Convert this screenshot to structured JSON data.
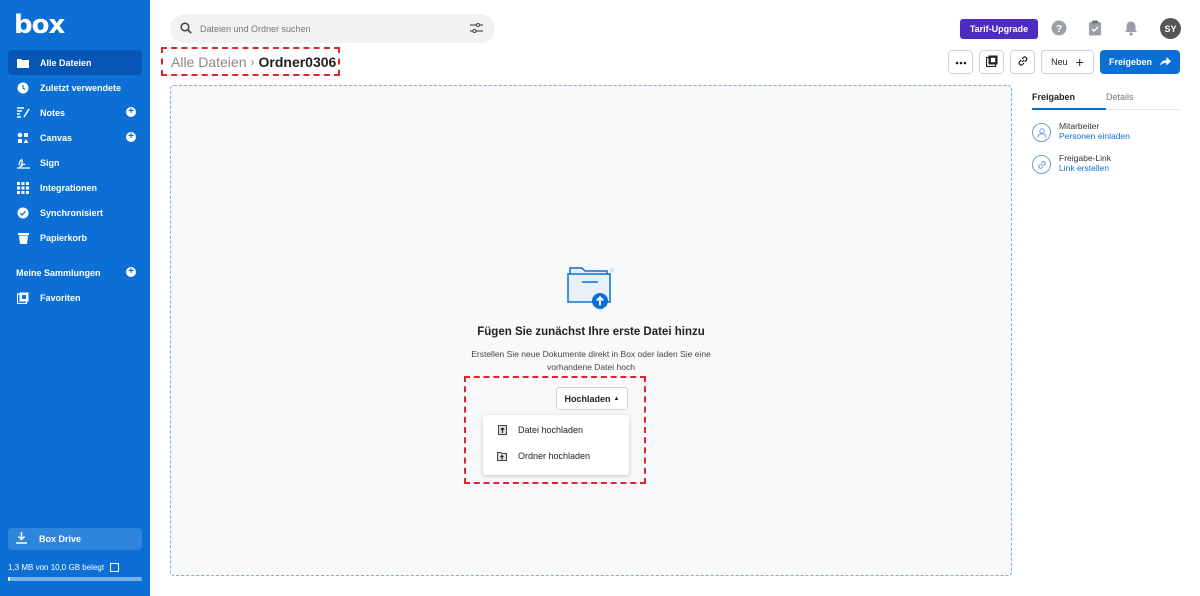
{
  "app": {
    "logo": "box"
  },
  "sidebar": {
    "items": [
      {
        "label": "Alle Dateien",
        "icon": "folder-icon",
        "active": true
      },
      {
        "label": "Zuletzt verwendete",
        "icon": "clock-icon"
      },
      {
        "label": "Notes",
        "icon": "notes-icon",
        "has_add": true
      },
      {
        "label": "Canvas",
        "icon": "canvas-icon",
        "has_add": true
      },
      {
        "label": "Sign",
        "icon": "signature-icon"
      },
      {
        "label": "Integrationen",
        "icon": "grid-icon"
      },
      {
        "label": "Synchronisiert",
        "icon": "check-circle-icon"
      },
      {
        "label": "Papierkorb",
        "icon": "trash-icon"
      }
    ],
    "collections_label": "Meine Sammlungen",
    "favorites_label": "Favoriten",
    "box_drive_label": "Box Drive",
    "storage_text": "1,3 MB von 10,0 GB belegt",
    "storage_used_fraction": 0.0001
  },
  "header": {
    "search_placeholder": "Dateien und Ordner suchen",
    "upgrade_label": "Tarif-Upgrade",
    "avatar_initials": "SY"
  },
  "breadcrumb": {
    "parent": "Alle Dateien",
    "current": "Ordner0306"
  },
  "toolbar": {
    "new_label": "Neu",
    "share_label": "Freigeben"
  },
  "empty_state": {
    "title": "Fügen Sie zunächst Ihre erste Datei hinzu",
    "description": "Erstellen Sie neue Dokumente direkt in Box oder laden Sie eine vorhandene Datei hoch",
    "upload_label": "Hochladen",
    "menu": [
      {
        "label": "Datei hochladen",
        "icon": "file-upload-icon"
      },
      {
        "label": "Ordner hochladen",
        "icon": "folder-upload-icon"
      }
    ]
  },
  "right_panel": {
    "tabs": [
      "Freigaben",
      "Details"
    ],
    "collaborators_title": "Mitarbeiter",
    "collaborators_link": "Personen einladen",
    "shared_link_title": "Freigabe-Link",
    "shared_link_link": "Link erstellen"
  },
  "colors": {
    "sidebar": "#0b6fd6",
    "accent": "#0b6fd6",
    "upgrade": "#4f2bc4",
    "highlight": "#e0252a"
  }
}
